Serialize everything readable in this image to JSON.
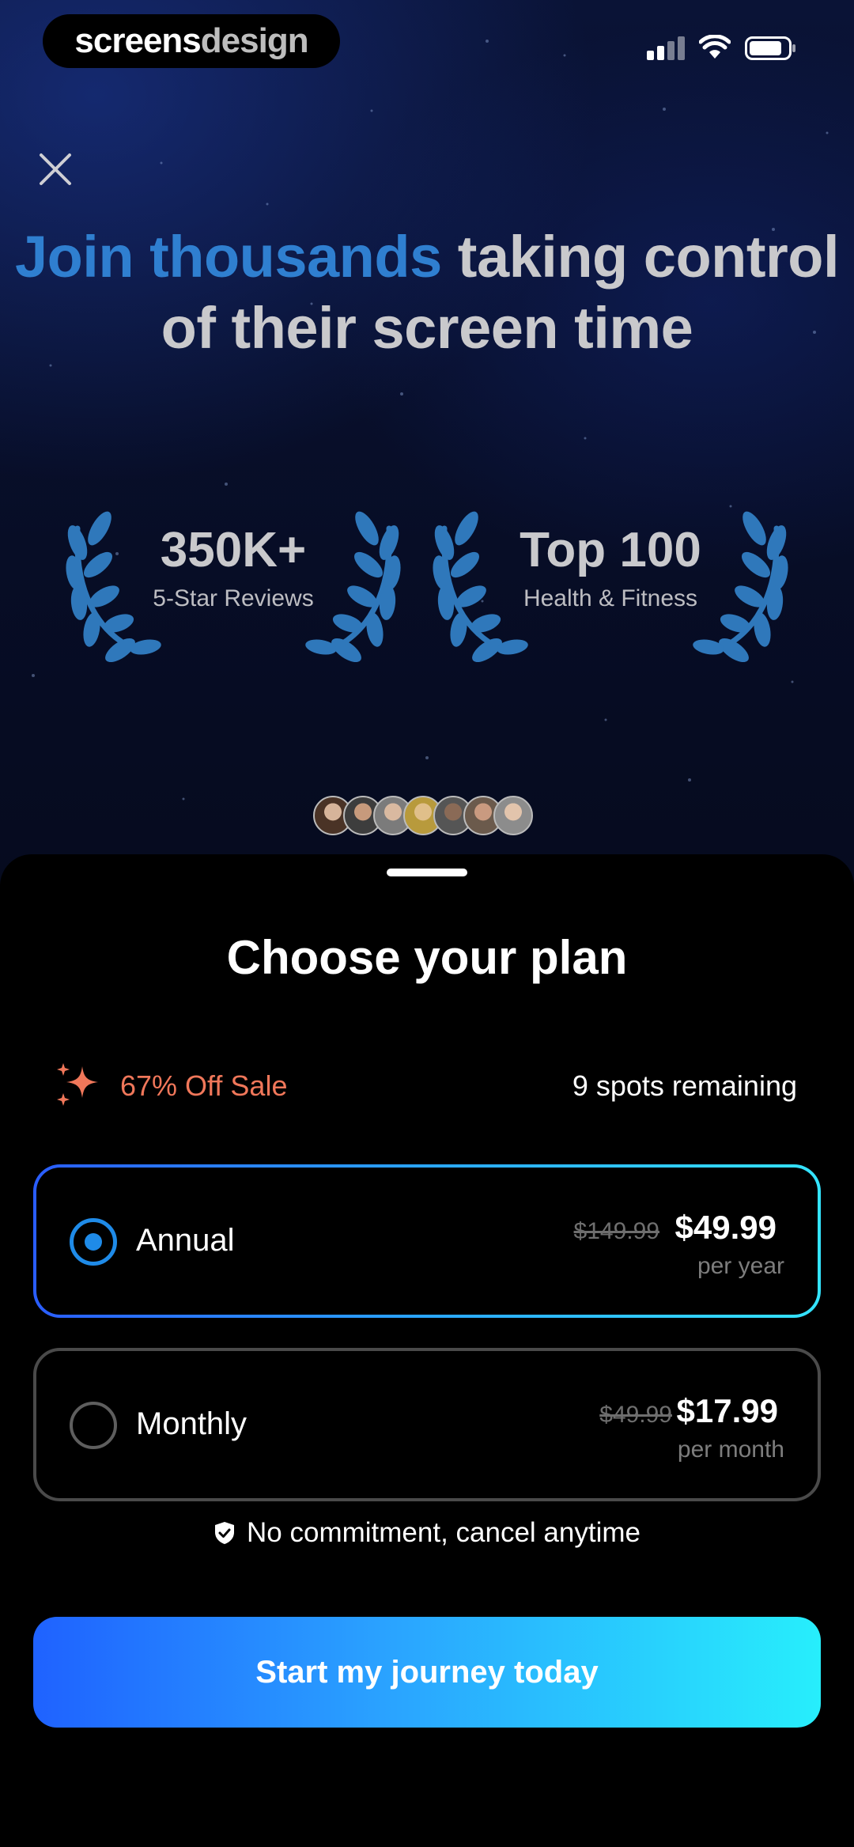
{
  "status_bar": {
    "brand_part1": "screens",
    "brand_part2": "design",
    "icons": [
      "cellular-signal-icon",
      "wifi-icon",
      "battery-icon"
    ]
  },
  "close_icon": "close-icon",
  "headline": {
    "accent": "Join thousands",
    "rest_line1": " taking control",
    "line2": "of their screen time",
    "accent_color": "#2f7fd0"
  },
  "awards": [
    {
      "value": "350K+",
      "label": "5-Star Reviews",
      "icon": "laurel-wreath-icon"
    },
    {
      "value": "Top 100",
      "label": "Health & Fitness",
      "icon": "laurel-wreath-icon"
    }
  ],
  "user_avatars": [
    "avatar-1",
    "avatar-2",
    "avatar-3",
    "avatar-4",
    "avatar-5",
    "avatar-6",
    "avatar-7"
  ],
  "sheet": {
    "title": "Choose your plan",
    "sale": {
      "icon": "sparkle-icon",
      "label": "67% Off Sale",
      "color": "#f0775a"
    },
    "spots": "9 spots remaining",
    "plans": [
      {
        "name": "Annual",
        "old_price": "$149.99",
        "price": "$49.99",
        "period": "per year",
        "selected": true
      },
      {
        "name": "Monthly",
        "old_price": "$49.99",
        "price": "$17.99",
        "period": "per month",
        "selected": false
      }
    ],
    "commitment": {
      "icon": "shield-check-icon",
      "text": "No commitment, cancel anytime"
    },
    "cta": "Start my journey today"
  },
  "colors": {
    "selected_radio": "#1f8be8",
    "cta_gradient": [
      "#1f62ff",
      "#2aa3ff",
      "#27eefc"
    ]
  }
}
